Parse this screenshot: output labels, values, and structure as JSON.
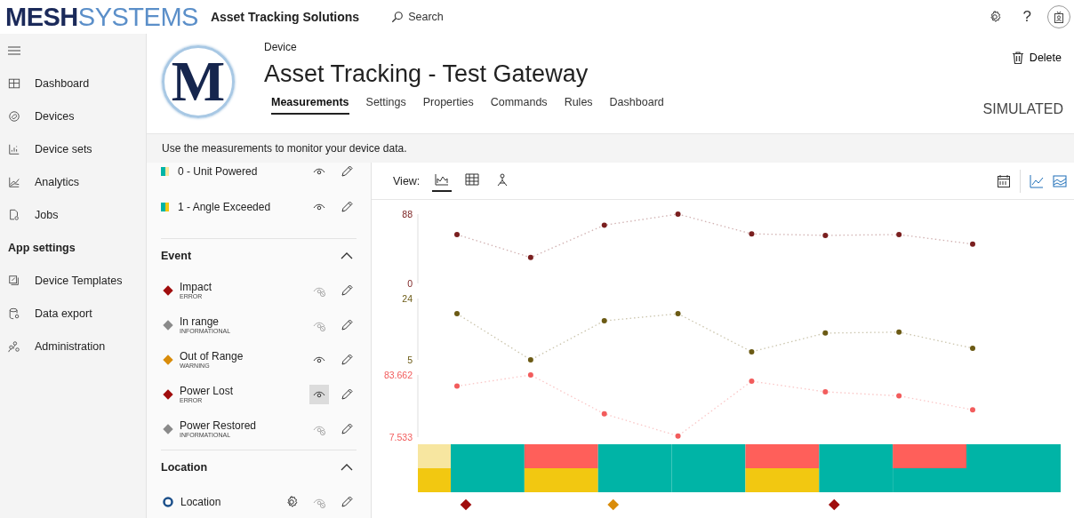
{
  "header": {
    "brand_bold": "MESH",
    "brand_light": "SYSTEMS",
    "app_name": "Asset Tracking Solutions",
    "help": "?",
    "search": {
      "placeholder": "Search"
    }
  },
  "sidebar": {
    "items": [
      {
        "label": "Dashboard",
        "kind": "dashboard"
      },
      {
        "label": "Devices",
        "kind": "devices"
      },
      {
        "label": "Device sets",
        "kind": "sets"
      },
      {
        "label": "Analytics",
        "kind": "analytics"
      },
      {
        "label": "Jobs",
        "kind": "jobs"
      }
    ],
    "section": "App settings",
    "settings_items": [
      {
        "label": "Device Templates",
        "kind": "templates"
      },
      {
        "label": "Data export",
        "kind": "export"
      },
      {
        "label": "Administration",
        "kind": "admin"
      }
    ]
  },
  "device": {
    "logo_letter": "M",
    "caption": "Device",
    "title": "Asset Tracking - Test Gateway",
    "tabs": [
      {
        "label": "Measurements",
        "selected": true
      },
      {
        "label": "Settings",
        "selected": false
      },
      {
        "label": "Properties",
        "selected": false
      },
      {
        "label": "Commands",
        "selected": false
      },
      {
        "label": "Rules",
        "selected": false
      },
      {
        "label": "Dashboard",
        "selected": false
      }
    ],
    "delete": "Delete",
    "badge": "SIMULATED"
  },
  "info": "Use the measurements to monitor your device data.",
  "measurements": {
    "states": [
      {
        "label": "0 - Unit Powered",
        "swatches": [
          {
            "color": "#00b4a6"
          },
          {
            "color": "#f7e6a0"
          }
        ],
        "visible": true
      },
      {
        "label": "1 - Angle Exceeded",
        "swatches": [
          {
            "color": "#00b4a6"
          },
          {
            "color": "#f2c811"
          }
        ],
        "visible": true
      }
    ],
    "sections": [
      {
        "title": "Event",
        "expanded": true,
        "items": [
          {
            "kind": "event",
            "label": "Impact",
            "severity": "ERROR",
            "color": "#a00d0d",
            "visible": false,
            "hovered": false
          },
          {
            "kind": "event",
            "label": "In range",
            "severity": "INFORMATIONAL",
            "color": "#8a8a8a",
            "visible": false,
            "hovered": false
          },
          {
            "kind": "event",
            "label": "Out of Range",
            "severity": "WARNING",
            "color": "#d98c0a",
            "visible": true,
            "hovered": false
          },
          {
            "kind": "event",
            "label": "Power Lost",
            "severity": "ERROR",
            "color": "#a00d0d",
            "visible": true,
            "hovered": true
          },
          {
            "kind": "event",
            "label": "Power Restored",
            "severity": "INFORMATIONAL",
            "color": "#8a8a8a",
            "visible": false,
            "hovered": false
          }
        ]
      },
      {
        "title": "Location",
        "expanded": true,
        "items": [
          {
            "kind": "location",
            "label": "Location",
            "visible": false,
            "hovered": false
          }
        ]
      }
    ]
  },
  "chart_panel": {
    "view_label": "View:",
    "views": [
      {
        "kind": "chart",
        "selected": true
      },
      {
        "kind": "grid",
        "selected": false
      },
      {
        "kind": "map",
        "selected": false
      }
    ],
    "charts": [
      {
        "chart_data": {
          "type": "line",
          "categories": [
            null,
            null,
            null,
            null,
            null,
            null,
            null,
            null
          ],
          "ylim": [
            0,
            88
          ],
          "yticks": [
            0,
            88
          ],
          "series": [
            {
              "color": "#7a1f1f",
              "line_style": "dotted",
              "marker": "circle",
              "values": [
                62,
                33,
                74,
                88,
                63,
                61,
                62,
                50
              ]
            }
          ]
        }
      },
      {
        "chart_data": {
          "type": "line",
          "categories": [
            null,
            null,
            null,
            null,
            null,
            null,
            null,
            null
          ],
          "ylim": [
            5,
            24
          ],
          "yticks": [
            5,
            24
          ],
          "series": [
            {
              "color": "#6b5a14",
              "line_style": "dotted",
              "marker": "circle",
              "values": [
                19.3,
                5,
                17.1,
                19.3,
                7.5,
                13.3,
                13.6,
                8.6
              ]
            }
          ]
        }
      },
      {
        "chart_data": {
          "type": "line",
          "categories": [
            null,
            null,
            null,
            null,
            null,
            null,
            null,
            null
          ],
          "ylim": [
            7.533,
            83.662
          ],
          "yticks": [
            7.533,
            83.662
          ],
          "series": [
            {
              "color": "#f25c5c",
              "line_style": "dotted",
              "marker": "circle",
              "values": [
                70,
                83.662,
                36,
                9,
                76,
                63,
                58,
                41
              ]
            }
          ]
        }
      }
    ],
    "state_rows": [
      {
        "cells": [
          {
            "color": "#f7e6a0"
          },
          {
            "color": "#00b4a6"
          },
          {
            "color": "#ff5f5a"
          },
          {
            "color": "#00b4a6"
          },
          {
            "color": "#00b4a6"
          },
          {
            "color": "#ff5f5a"
          },
          {
            "color": "#00b4a6"
          },
          {
            "color": "#ff5f5a"
          },
          {
            "color": "#00b4a6"
          }
        ]
      },
      {
        "cells": [
          {
            "color": "#f2c811"
          },
          {
            "color": "#00b4a6"
          },
          {
            "color": "#f2c811"
          },
          {
            "color": "#00b4a6"
          },
          {
            "color": "#00b4a6"
          },
          {
            "color": "#f2c811"
          },
          {
            "color": "#00b4a6"
          },
          {
            "color": "#00b4a6"
          },
          {
            "color": "#00b4a6"
          }
        ]
      }
    ],
    "event_marks": [
      {
        "kind": "error"
      },
      {
        "kind": "none"
      },
      {
        "kind": "warning"
      },
      {
        "kind": "none"
      },
      {
        "kind": "none"
      },
      {
        "kind": "error"
      },
      {
        "kind": "none"
      },
      {
        "kind": "none"
      }
    ]
  }
}
